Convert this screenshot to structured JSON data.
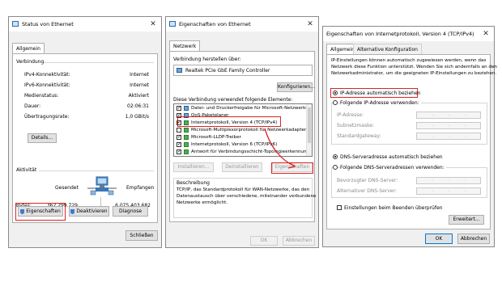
{
  "w1": {
    "title": "Status von Ethernet",
    "tab": "Allgemein",
    "connection_heading": "Verbindung",
    "rows": [
      {
        "label": "IPv4-Konnektivität:",
        "value": "Internet"
      },
      {
        "label": "IPv6-Konnektivität:",
        "value": "Internet"
      },
      {
        "label": "Medienstatus:",
        "value": "Aktiviert"
      },
      {
        "label": "Dauer:",
        "value": "02:06:31"
      },
      {
        "label": "Übertragungsrate:",
        "value": "1,0 GBit/s"
      }
    ],
    "details_btn": "Details...",
    "activity_heading": "Aktivität",
    "sent_label": "Gesendet",
    "received_label": "Empfangen",
    "bytes_label": "Bytes:",
    "bytes_sent": "362.299.729",
    "bytes_received": "6.075.403.682",
    "properties_btn": "Eigenschaften",
    "disable_btn": "Deaktivieren",
    "diagnose_btn": "Diagnose",
    "close_btn": "Schließen"
  },
  "w2": {
    "title": "Eigenschaften von Ethernet",
    "tab": "Netzwerk",
    "connect_using_label": "Verbindung herstellen über:",
    "adapter": "Realtek PCIe GbE Family Controller",
    "configure_btn": "Konfigurieren...",
    "items_label": "Diese Verbindung verwendet folgende Elemente:",
    "items": [
      {
        "label": "Datei- und Druckerfreigabe für Microsoft-Netzwerke",
        "checked": true
      },
      {
        "label": "QoS-Paketplaner",
        "checked": true
      },
      {
        "label": "Internetprotokoll, Version 4 (TCP/IPv4)",
        "checked": true
      },
      {
        "label": "Microsoft-Multiplexorprotokoll für Netzwerkadapter",
        "checked": false
      },
      {
        "label": "Microsoft-LLDP-Treiber",
        "checked": true
      },
      {
        "label": "Internetprotokoll, Version 6 (TCP/IPv6)",
        "checked": true
      },
      {
        "label": "Antwort für Verbindungsschicht-Topologieerkennung",
        "checked": true
      }
    ],
    "install_btn": "Installieren...",
    "uninstall_btn": "Deinstallieren",
    "properties_btn": "Eigenschaften",
    "description_heading": "Beschreibung",
    "description": [
      "TCP/IP, das Standardprotokoll für WAN-Netzwerke, das den",
      "Datenaustausch über verschiedene, miteinander verbundene",
      "Netzwerke ermöglicht."
    ],
    "ok_btn": "OK",
    "cancel_btn": "Abbrechen"
  },
  "w3": {
    "title": "Eigenschaften von Internetprotokoll, Version 4 (TCP/IPv4)",
    "tab_general": "Allgemein",
    "tab_alt": "Alternative Konfiguration",
    "intro": [
      "IP-Einstellungen können automatisch zugewiesen werden, wenn das",
      "Netzwerk diese Funktion unterstützt. Wenden Sie sich andernfalls an den",
      "Netzwerkadministrator, um die geeigneten IP-Einstellungen zu beziehen."
    ],
    "radio_auto_ip": "IP-Adresse automatisch beziehen",
    "radio_manual_ip": "Folgende IP-Adresse verwenden:",
    "ip_label": "IP-Adresse:",
    "subnet_label": "Subnetzmaske:",
    "gateway_label": "Standardgateway:",
    "radio_auto_dns": "DNS-Serveradresse automatisch beziehen",
    "radio_manual_dns": "Folgende DNS-Serveradressen verwenden:",
    "dns_pref_label": "Bevorzugter DNS-Server:",
    "dns_alt_label": "Alternativer DNS-Server:",
    "validate_label": "Einstellungen beim Beenden überprüfen",
    "advanced_btn": "Erweitert...",
    "ok_btn": "OK",
    "cancel_btn": "Abbrechen"
  },
  "colors": {
    "highlight": "#d92525",
    "selection": "#0078d7"
  }
}
